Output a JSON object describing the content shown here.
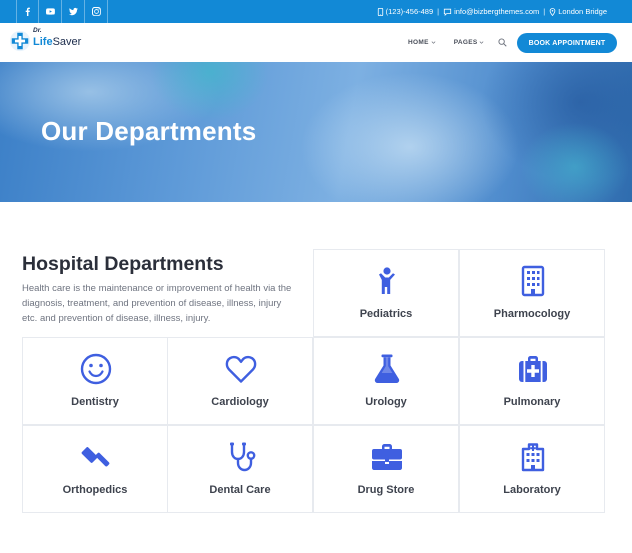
{
  "topbar": {
    "social_icons": [
      "facebook-icon",
      "youtube-icon",
      "twitter-icon",
      "instagram-icon"
    ],
    "phone": "(123)-456-489",
    "email": "info@bizbergthemes.com",
    "location": "London Bridge",
    "separator": "|"
  },
  "header": {
    "logo_prefix": "Dr.",
    "logo_name_first": "Life",
    "logo_name_rest": "Saver",
    "nav": [
      {
        "label": "HOME"
      },
      {
        "label": "PAGES"
      }
    ],
    "cta": "BOOK APPOINTMENT"
  },
  "hero": {
    "title": "Our Departments"
  },
  "section": {
    "title": "Hospital Departments",
    "description": "Health care is the maintenance or improvement of health via the diagnosis, treatment, and prevention of disease, illness, injury etc. and prevention of disease, illness, injury."
  },
  "departments": [
    {
      "label": "Pediatrics",
      "icon": "child-icon"
    },
    {
      "label": "Pharmocology",
      "icon": "building-icon"
    },
    {
      "label": "Dentistry",
      "icon": "smile-icon"
    },
    {
      "label": "Cardiology",
      "icon": "heart-icon"
    },
    {
      "label": "Urology",
      "icon": "flask-icon"
    },
    {
      "label": "Pulmonary",
      "icon": "medkit-icon"
    },
    {
      "label": "Orthopedics",
      "icon": "gavel-icon"
    },
    {
      "label": "Dental Care",
      "icon": "stethoscope-icon"
    },
    {
      "label": "Drug Store",
      "icon": "briefcase-icon"
    },
    {
      "label": "Laboratory",
      "icon": "hospital-icon"
    }
  ],
  "colors": {
    "brand": "#1289d6",
    "icon": "#3f5fe0",
    "heading": "#2b2f3a",
    "text": "#6f7480"
  }
}
